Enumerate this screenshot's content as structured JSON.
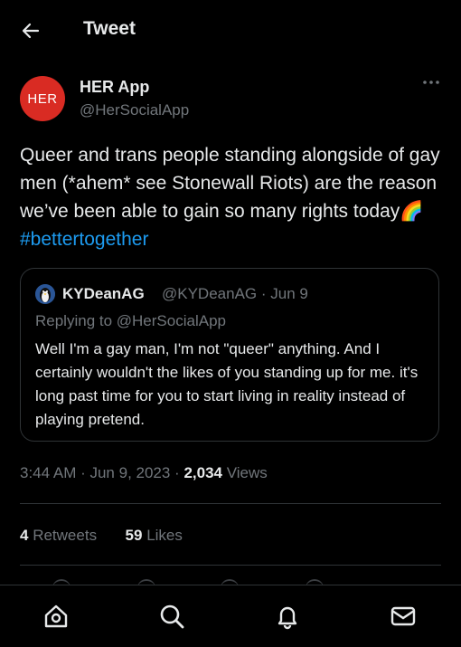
{
  "header": {
    "title": "Tweet",
    "back_icon": "back-arrow-icon"
  },
  "author": {
    "avatar_text": "HER",
    "avatar_color": "#d92b23",
    "name": "HER App",
    "handle": "@HerSocialApp"
  },
  "tweet": {
    "text": "Queer and trans people standing alongside of gay men (*ahem* see Stonewall Riots) are the reason we’ve been able to gain so many rights today",
    "emoji": "🌈",
    "hashtag": "#bettertogether"
  },
  "quote": {
    "name": "KYDeanAG",
    "meta": "@KYDeanAG · Jun 9",
    "replying_to": "Replying to @HerSocialApp",
    "text": "Well I'm a gay man, I'm not \"queer\" anything. And I certainly wouldn't the likes of you standing up for me. it's long past time for you to start living in reality instead of playing pretend."
  },
  "timestamp": {
    "time": "3:44 AM · Jun 9, 2023 · ",
    "views": "2,034",
    "views_label": " Views"
  },
  "stats": {
    "retweets": "4",
    "retweets_label": "Retweets",
    "likes": "59",
    "likes_label": "Likes"
  },
  "colors": {
    "accent": "#1d9bf0",
    "muted": "#71767b",
    "border": "#2f3336",
    "background": "#000000"
  },
  "tabbar": {
    "icons": [
      "home-icon",
      "search-icon",
      "notifications-icon",
      "messages-icon"
    ]
  }
}
